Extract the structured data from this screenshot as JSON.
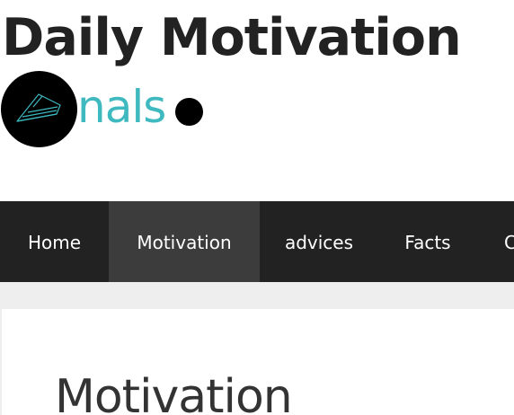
{
  "header": {
    "site_title": "Daily Motivation",
    "logo": {
      "text": "nals",
      "icon": "paper-plane-icon",
      "text_color": "#3fb9c0",
      "circle_color": "#000000"
    }
  },
  "nav": {
    "background": "#222222",
    "active_background": "#3c3c3c",
    "items": [
      {
        "label": "Home",
        "active": false
      },
      {
        "label": "Motivation",
        "active": true
      },
      {
        "label": "advices",
        "active": false
      },
      {
        "label": "Facts",
        "active": false
      },
      {
        "label": "C",
        "active": false
      }
    ]
  },
  "main": {
    "heading": "Motivation"
  }
}
